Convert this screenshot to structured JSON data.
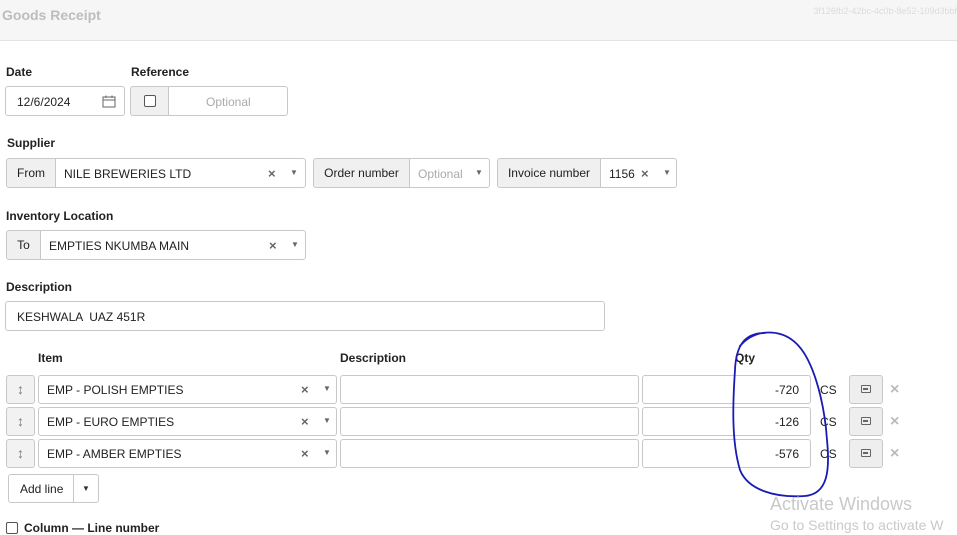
{
  "page": {
    "title": "Goods Receipt",
    "guid": "3f126fb2-42bc-4c0b-8e52-109d3bbf"
  },
  "date": {
    "label": "Date",
    "value": "12/6/2024"
  },
  "reference": {
    "label": "Reference",
    "placeholder": "Optional"
  },
  "supplier": {
    "label": "Supplier",
    "from_label": "From",
    "value": "NILE BREWERIES LTD",
    "order_label": "Order number",
    "order_placeholder": "Optional",
    "invoice_label": "Invoice number",
    "invoice_value": "1156"
  },
  "inventory": {
    "label": "Inventory Location",
    "to_label": "To",
    "value": "EMPTIES NKUMBA MAIN"
  },
  "description": {
    "label": "Description",
    "value": "KESHWALA  UAZ 451R"
  },
  "lines": {
    "headers": {
      "item": "Item",
      "description": "Description",
      "qty": "Qty"
    },
    "rows": [
      {
        "item": "EMP - POLISH EMPTIES",
        "description": "",
        "qty": "-720",
        "uom": "CS"
      },
      {
        "item": "EMP - EURO EMPTIES",
        "description": "",
        "qty": "-126",
        "uom": "CS"
      },
      {
        "item": "EMP - AMBER EMPTIES",
        "description": "",
        "qty": "-576",
        "uom": "CS"
      }
    ],
    "add_line_label": "Add line"
  },
  "column_option": {
    "label": "Column — Line number"
  },
  "watermark": {
    "line1": "Activate Windows",
    "line2": "Go to Settings to activate W"
  },
  "colors": {
    "annotation": "#1a1ab5",
    "border": "#c8c8c8",
    "addon_bg": "#f0f0f0"
  }
}
